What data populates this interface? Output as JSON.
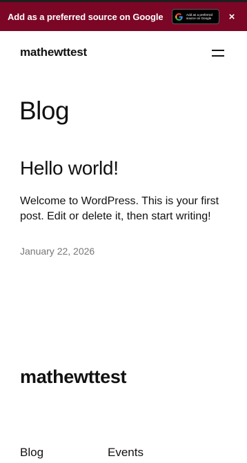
{
  "banner": {
    "text": "Add as a preferred source on Google",
    "badge_line1": "Add as a preferred",
    "badge_line2": "source on Google",
    "close_label": "×",
    "background": "#7b0626"
  },
  "header": {
    "site_title": "mathewttest",
    "menu_icon": "hamburger-menu-icon"
  },
  "main": {
    "page_title": "Blog",
    "posts": [
      {
        "title": "Hello world!",
        "excerpt": "Welcome to WordPress. This is your first post. Edit or delete it, then start writing!",
        "date": "January 22, 2026"
      }
    ]
  },
  "footer": {
    "site_title": "mathewttest",
    "links": [
      "Blog",
      "Events"
    ]
  }
}
